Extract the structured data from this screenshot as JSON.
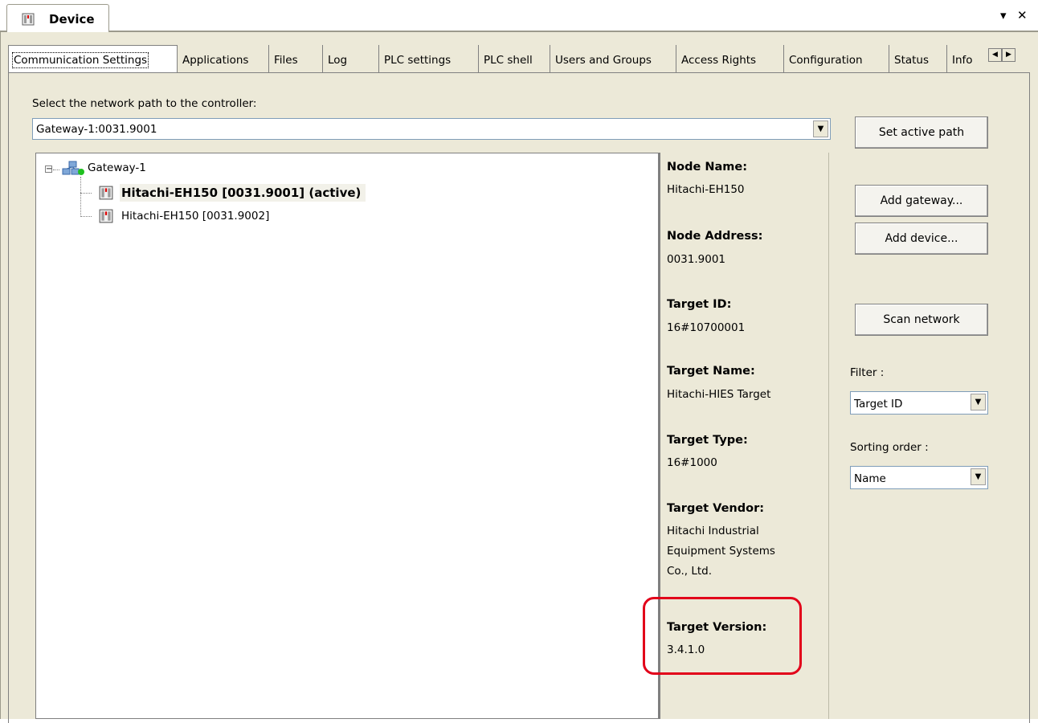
{
  "document_tab": {
    "title": "Device",
    "dropdown_icon": "triangle-down-icon",
    "close_icon": "close-x-icon"
  },
  "tabs": [
    {
      "label": "Communication Settings",
      "active": true
    },
    {
      "label": "Applications"
    },
    {
      "label": "Files"
    },
    {
      "label": "Log"
    },
    {
      "label": "PLC settings"
    },
    {
      "label": "PLC shell"
    },
    {
      "label": "Users and Groups"
    },
    {
      "label": "Access Rights"
    },
    {
      "label": "Configuration"
    },
    {
      "label": "Status"
    },
    {
      "label": "Info"
    }
  ],
  "network_path": {
    "label": "Select the network path to the controller:",
    "value": "Gateway-1:0031.9001"
  },
  "buttons": {
    "set_active_path": "Set active path",
    "add_gateway": "Add gateway...",
    "add_device": "Add device...",
    "scan_network": "Scan network"
  },
  "tree": {
    "gateway": "Gateway-1",
    "devices": [
      {
        "label": "Hitachi-EH150 [0031.9001] (active)",
        "selected": true
      },
      {
        "label": "Hitachi-EH150 [0031.9002]",
        "selected": false
      }
    ]
  },
  "info": {
    "node_name_label": "Node Name:",
    "node_name": "Hitachi-EH150",
    "node_address_label": "Node Address:",
    "node_address": "0031.9001",
    "target_id_label": "Target ID:",
    "target_id": "16#10700001",
    "target_name_label": "Target Name:",
    "target_name": "Hitachi-HIES Target",
    "target_type_label": "Target Type:",
    "target_type": "16#1000",
    "target_vendor_label": "Target Vendor:",
    "target_vendor": "Hitachi Industrial Equipment Systems Co., Ltd.",
    "target_version_label": "Target Version:",
    "target_version": "3.4.1.0"
  },
  "filter": {
    "label": "Filter :",
    "value": "Target ID"
  },
  "sorting": {
    "label": "Sorting order :",
    "value": "Name"
  },
  "colors": {
    "highlight": "#e2001a",
    "panel_bg": "#ece9d8"
  }
}
